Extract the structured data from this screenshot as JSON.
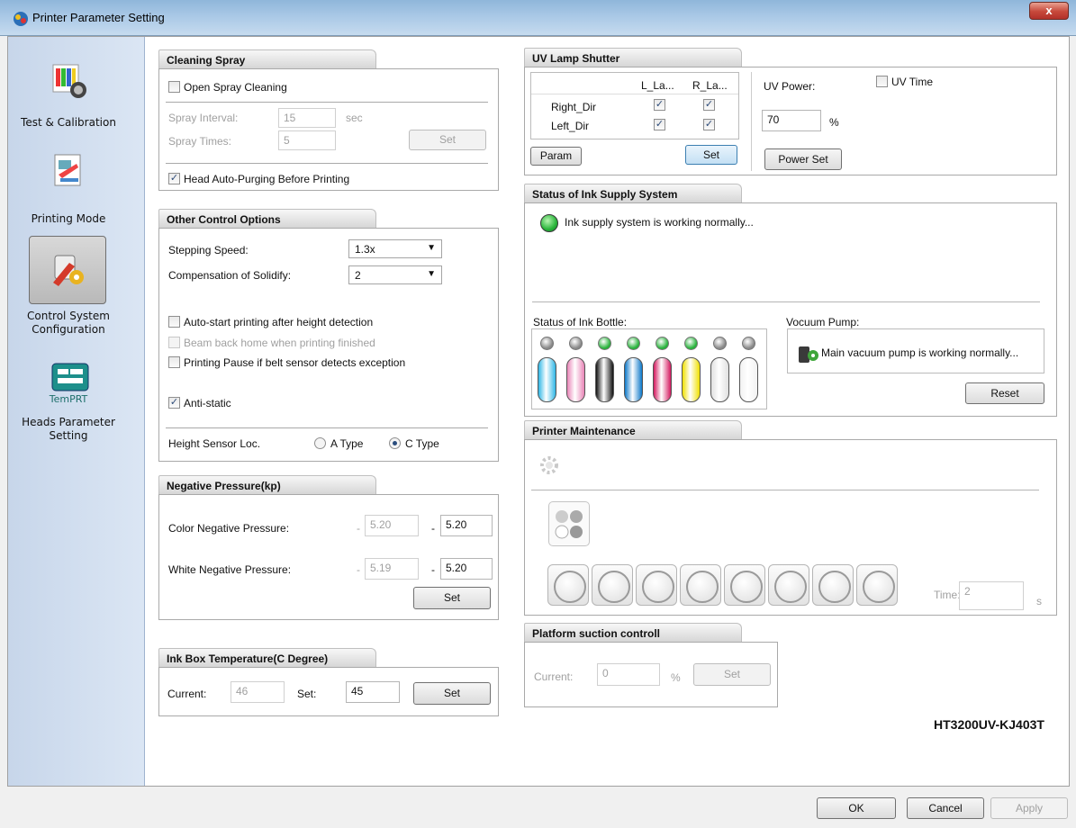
{
  "window": {
    "title": "Printer Parameter Setting",
    "close": "x"
  },
  "sidebar": {
    "items": [
      {
        "label": "Test & Calibration"
      },
      {
        "label": "Printing Mode"
      },
      {
        "label": "Control System",
        "label2": "Configuration"
      },
      {
        "label": "Heads Parameter",
        "label2": "Setting",
        "icon_text": "TemPRT"
      }
    ]
  },
  "cleaning": {
    "header": "Cleaning Spray",
    "open_spray_label": "Open Spray Cleaning",
    "spray_interval_label": "Spray Interval:",
    "spray_interval_value": "15",
    "spray_interval_unit": "sec",
    "spray_times_label": "Spray Times:",
    "spray_times_value": "5",
    "set_label": "Set",
    "auto_purge_label": "Head Auto-Purging Before Printing"
  },
  "other": {
    "header": "Other Control Options",
    "stepping_label": "Stepping Speed:",
    "stepping_value": "1.3x",
    "comp_label": "Compensation of Solidify:",
    "comp_value": "2",
    "auto_start_label": "Auto-start printing after height detection",
    "beam_back_label": "Beam back home when printing finished",
    "pause_label": "Printing Pause if belt sensor detects exception",
    "antistatic_label": "Anti-static",
    "height_sensor_label": "Height Sensor Loc.",
    "a_type_label": "A Type",
    "c_type_label": "C Type"
  },
  "negative": {
    "header": "Negative Pressure(kp)",
    "color_label": "Color Negative Pressure:",
    "color_dash1": "-",
    "color_current": "5.20",
    "color_dash2": "-",
    "color_set": "5.20",
    "white_label": "White Negative Pressure:",
    "white_dash1": "-",
    "white_current": "5.19",
    "white_dash2": "-",
    "white_set": "5.20",
    "set_label": "Set"
  },
  "inkbox": {
    "header": "Ink Box Temperature(C Degree)",
    "current_label": "Current:",
    "current_value": "46",
    "set_text": "Set:",
    "set_value": "45",
    "set_button": "Set"
  },
  "uv": {
    "header": "UV Lamp Shutter",
    "col1": "L_La...",
    "col2": "R_La...",
    "row1": "Right_Dir",
    "row2": "Left_Dir",
    "param_label": "Param",
    "set_label": "Set",
    "power_label": "UV Power:",
    "uv_time_label": "UV Time",
    "power_value": "70",
    "power_unit": "%",
    "power_set_label": "Power Set"
  },
  "ink_status": {
    "header": "Status of Ink Supply System",
    "message": "Ink supply system is working normally...",
    "bottle_label": "Status of Ink Bottle:",
    "bottle_colors": [
      "#2fb7e6",
      "#e985b7",
      "#111111",
      "#0d78c9",
      "#d4195f",
      "#f0e000",
      "#e0e0e0",
      "#f2f2f2"
    ],
    "led_colors": [
      "#888888",
      "#888888",
      "#27b23a",
      "#27b23a",
      "#27b23a",
      "#27b23a",
      "#888888",
      "#888888"
    ],
    "vacuum_label": "Vocuum Pump:",
    "vacuum_message": "Main vacuum pump is working normally...",
    "reset_label": "Reset"
  },
  "maintenance": {
    "header": "Printer Maintenance",
    "time_label": "Time:",
    "time_value": "2",
    "time_unit": "s"
  },
  "platform": {
    "header": "Platform suction controll",
    "current_label": "Current:",
    "current_value": "0",
    "unit": "%",
    "set_label": "Set"
  },
  "model": "HT3200UV-KJ403T",
  "footer": {
    "ok": "OK",
    "cancel": "Cancel",
    "apply": "Apply"
  }
}
